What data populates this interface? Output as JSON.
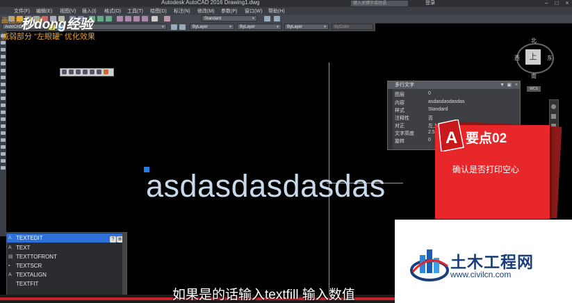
{
  "app": {
    "title": "Autodesk AutoCAD 2016    Drawing1.dwg",
    "search_placeholder": "键入关键字或短语",
    "user": "登录"
  },
  "menu": [
    "文件(F)",
    "编辑(E)",
    "视图(V)",
    "插入(I)",
    "格式(O)",
    "工具(T)",
    "绘图(D)",
    "标注(N)",
    "修改(M)",
    "参数(P)",
    "窗口(W)",
    "帮助(H)"
  ],
  "toolbar": {
    "textstyle": "Standard",
    "workspace": "AutoCAD 经典",
    "layer": "ByLayer",
    "linetype": "ByLayer",
    "lineweight": "ByLayer",
    "plotstyle": "ByColor"
  },
  "overlay": {
    "brand": "秒dong经验",
    "note_top": "画图技术交流",
    "note": "减弱部分 \"左眼罐\" 优化效果"
  },
  "canvas": {
    "text": "asdasdasdasdas"
  },
  "viewcube": {
    "north": "北",
    "south": "南",
    "east": "东",
    "west": "西",
    "top": "上",
    "wcs": "WCS"
  },
  "properties": {
    "title": "多行文字",
    "rows": [
      {
        "key": "图层",
        "value": "0"
      },
      {
        "key": "内容",
        "value": "asdasdasdasdas"
      },
      {
        "key": "样式",
        "value": "Standard"
      },
      {
        "key": "注释性",
        "value": "否"
      },
      {
        "key": "对正",
        "value": "左上"
      },
      {
        "key": "文字高度",
        "value": "2.5"
      },
      {
        "key": "旋转",
        "value": "0"
      }
    ]
  },
  "card": {
    "title": "要点02",
    "subtitle": "确认是否打印空心"
  },
  "command_popup": {
    "items": [
      "TEXTEDIT",
      "TEXT",
      "TEXTTOFRONT",
      "TEXTSCR",
      "TEXTALIGN",
      "TEXTFIT"
    ],
    "selected": 0
  },
  "subtitle": "如果是的话输入textfill 输入数值",
  "watermark": {
    "name": "土木工程网",
    "url": "www.civilcn.com"
  },
  "colors": {
    "accent_red": "#e8272b",
    "grip_blue": "#1e7fe8",
    "brand_blue": "#1b3f7a"
  }
}
